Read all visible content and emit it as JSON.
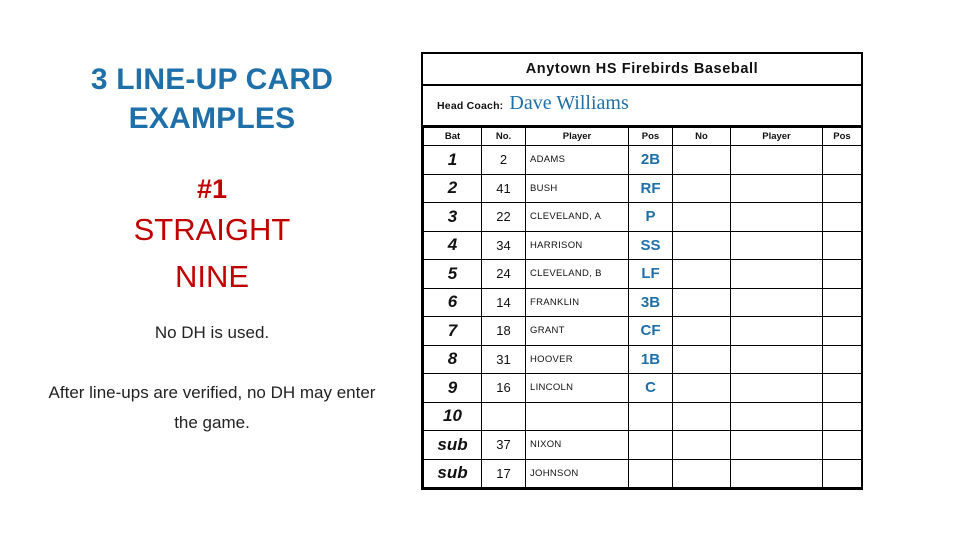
{
  "left": {
    "title": "3 LINE-UP CARD EXAMPLES",
    "subtitle_number": "#1",
    "subtitle_line1": "STRAIGHT",
    "subtitle_line2": "NINE",
    "note1": "No DH is used.",
    "note2": "After line-ups are verified, no DH may enter the game."
  },
  "card": {
    "header": "Anytown HS Firebirds Baseball",
    "coach_label": "Head Coach:",
    "coach_name": "Dave Williams",
    "columns": [
      "Bat",
      "No.",
      "Player",
      "Pos",
      "No",
      "Player",
      "Pos"
    ],
    "rows": [
      {
        "bat": "1",
        "no": "2",
        "player": "ADAMS",
        "pos": "2B",
        "no2": "",
        "player2": "",
        "pos2": ""
      },
      {
        "bat": "2",
        "no": "41",
        "player": "BUSH",
        "pos": "RF",
        "no2": "",
        "player2": "",
        "pos2": ""
      },
      {
        "bat": "3",
        "no": "22",
        "player": "CLEVELAND, A",
        "pos": "P",
        "no2": "",
        "player2": "",
        "pos2": ""
      },
      {
        "bat": "4",
        "no": "34",
        "player": "HARRISON",
        "pos": "SS",
        "no2": "",
        "player2": "",
        "pos2": ""
      },
      {
        "bat": "5",
        "no": "24",
        "player": "CLEVELAND, B",
        "pos": "LF",
        "no2": "",
        "player2": "",
        "pos2": ""
      },
      {
        "bat": "6",
        "no": "14",
        "player": "FRANKLIN",
        "pos": "3B",
        "no2": "",
        "player2": "",
        "pos2": ""
      },
      {
        "bat": "7",
        "no": "18",
        "player": "GRANT",
        "pos": "CF",
        "no2": "",
        "player2": "",
        "pos2": ""
      },
      {
        "bat": "8",
        "no": "31",
        "player": "HOOVER",
        "pos": "1B",
        "no2": "",
        "player2": "",
        "pos2": ""
      },
      {
        "bat": "9",
        "no": "16",
        "player": "LINCOLN",
        "pos": "C",
        "no2": "",
        "player2": "",
        "pos2": ""
      },
      {
        "bat": "10",
        "no": "",
        "player": "",
        "pos": "",
        "no2": "",
        "player2": "",
        "pos2": ""
      },
      {
        "bat": "sub",
        "no": "37",
        "player": "NIXON",
        "pos": "",
        "no2": "",
        "player2": "",
        "pos2": ""
      },
      {
        "bat": "sub",
        "no": "17",
        "player": "JOHNSON",
        "pos": "",
        "no2": "",
        "player2": "",
        "pos2": ""
      }
    ]
  },
  "colors": {
    "accent_blue": "#1F6FA8",
    "accent_red": "#C00000"
  }
}
